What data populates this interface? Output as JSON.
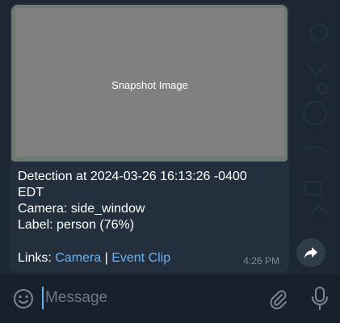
{
  "message": {
    "snapshot_label": "Snapshot Image",
    "line1": "Detection at 2024-03-26 16:13:26 -0400",
    "line2": "EDT",
    "line3": "Camera: side_window",
    "line4": "Label: person (76%)",
    "links_prefix": "Links: ",
    "link_camera": "Camera",
    "link_separator": " | ",
    "link_event_clip": "Event Clip",
    "time": "4:26 PM"
  },
  "input": {
    "placeholder": "Message"
  },
  "icons": {
    "share": "share-arrow-icon",
    "emoji": "emoji-icon",
    "attach": "paperclip-icon",
    "mic": "microphone-icon"
  },
  "colors": {
    "background": "#1c2733",
    "bubble": "#232f3d",
    "link": "#6ab3f3",
    "input_bar": "#17212b"
  }
}
